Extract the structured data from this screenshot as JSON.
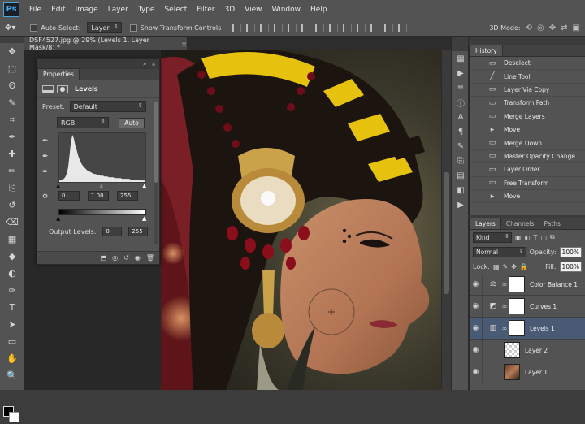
{
  "app": {
    "logo": "Ps"
  },
  "menu": [
    "File",
    "Edit",
    "Image",
    "Layer",
    "Type",
    "Select",
    "Filter",
    "3D",
    "View",
    "Window",
    "Help"
  ],
  "options": {
    "auto_select_label": "Auto-Select:",
    "auto_select_value": "Layer",
    "show_transform_label": "Show Transform Controls",
    "mode3d_label": "3D Mode:"
  },
  "document_tab": {
    "title": "DSF4527.jpg @ 29% (Levels 1, Layer Mask/8) *",
    "close": "×"
  },
  "tools": [
    "move-tool",
    "marquee-tool",
    "lasso-tool",
    "quick-select-tool",
    "crop-tool",
    "eyedropper-tool",
    "healing-tool",
    "brush-tool",
    "clone-tool",
    "history-brush-tool",
    "eraser-tool",
    "gradient-tool",
    "blur-tool",
    "dodge-tool",
    "pen-tool",
    "type-tool",
    "path-select-tool",
    "shape-tool",
    "hand-tool",
    "zoom-tool"
  ],
  "tool_glyphs": [
    "✥",
    "⬚",
    "ʘ",
    "✎",
    "⌗",
    "✒",
    "✚",
    "✏",
    "⎘",
    "↺",
    "⌫",
    "▦",
    "◆",
    "◐",
    "✑",
    "T",
    "➤",
    "▭",
    "✋",
    "🔍"
  ],
  "colors": {
    "foreground": "#000000",
    "background": "#ffffff",
    "selected_layer": "#495a75"
  },
  "properties": {
    "tab": "Properties",
    "title": "Levels",
    "preset_label": "Preset:",
    "preset_value": "Default",
    "channel": "RGB",
    "auto_button": "Auto",
    "input_black": "0",
    "input_gamma": "1.00",
    "input_white": "255",
    "output_label": "Output Levels:",
    "output_black": "0",
    "output_white": "255"
  },
  "history": {
    "tab": "History",
    "items": [
      {
        "label": "Deselect",
        "icon": "doc-icon"
      },
      {
        "label": "Line Tool",
        "icon": "line-icon"
      },
      {
        "label": "Layer Via Copy",
        "icon": "doc-icon"
      },
      {
        "label": "Transform Path",
        "icon": "doc-icon"
      },
      {
        "label": "Merge Layers",
        "icon": "doc-icon"
      },
      {
        "label": "Move",
        "icon": "move-icon"
      },
      {
        "label": "Merge Down",
        "icon": "doc-icon"
      },
      {
        "label": "Master Opacity Change",
        "icon": "doc-icon"
      },
      {
        "label": "Layer Order",
        "icon": "doc-icon"
      },
      {
        "label": "Free Transform",
        "icon": "doc-icon"
      },
      {
        "label": "Move",
        "icon": "move-icon"
      }
    ]
  },
  "layers": {
    "tabs": [
      "Layers",
      "Channels",
      "Paths"
    ],
    "filter_kind": "Kind",
    "blend_mode": "Normal",
    "opacity_label": "Opacity:",
    "opacity_value": "100%",
    "lock_label": "Lock:",
    "fill_label": "Fill:",
    "fill_value": "100%",
    "items": [
      {
        "name": "Color Balance 1",
        "kind": "adjustment",
        "icon": "⚖"
      },
      {
        "name": "Curves 1",
        "kind": "adjustment",
        "icon": "◩"
      },
      {
        "name": "Levels 1",
        "kind": "adjustment",
        "icon": "▥",
        "selected": true
      },
      {
        "name": "Layer 2",
        "kind": "transparent"
      },
      {
        "name": "Layer 1",
        "kind": "photo"
      }
    ]
  },
  "histogram": [
    2,
    2,
    3,
    4,
    6,
    10,
    18,
    34,
    52,
    60,
    55,
    46,
    40,
    33,
    28,
    24,
    21,
    19,
    17,
    15,
    14,
    13,
    12,
    11,
    10,
    10,
    9,
    9,
    8,
    8,
    8,
    7,
    7,
    7,
    6,
    6,
    6,
    6,
    5,
    5,
    5,
    5,
    5,
    4,
    4,
    4,
    4,
    4,
    4,
    3,
    3,
    3,
    3,
    3,
    3,
    3,
    2,
    2,
    2,
    2
  ]
}
